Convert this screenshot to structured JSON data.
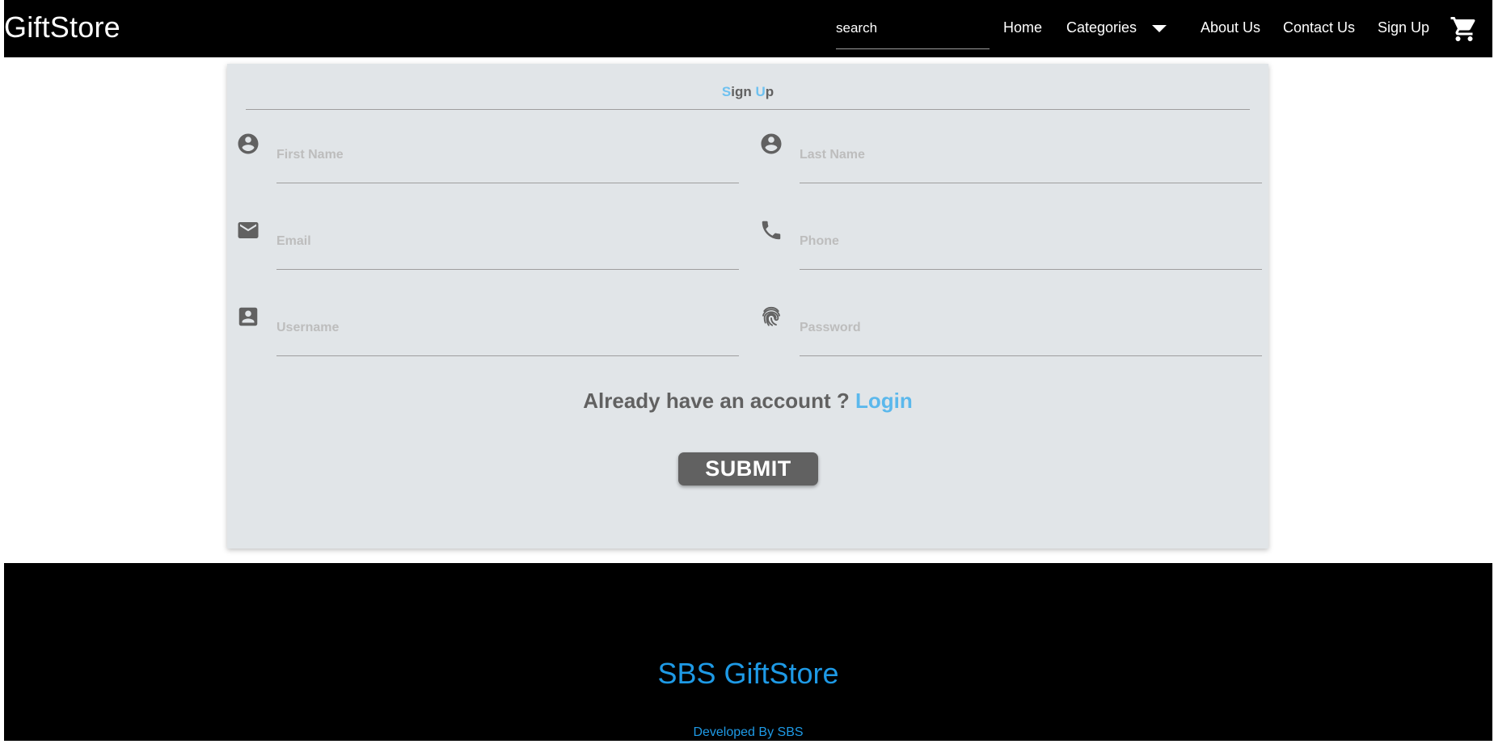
{
  "navbar": {
    "brand": "GiftStore",
    "search_placeholder": "search",
    "links": {
      "home": "Home",
      "categories": "Categories",
      "about": "About Us",
      "contact": "Contact Us",
      "signup": "Sign Up"
    },
    "cart_icon": "shopping-cart-icon",
    "dropdown_icon": "caret-down-icon"
  },
  "form": {
    "title_parts": [
      "S",
      "ign ",
      "U",
      "p"
    ],
    "fields": {
      "first_name": {
        "placeholder": "First Name",
        "value": "",
        "icon": "account-circle-icon"
      },
      "last_name": {
        "placeholder": "Last Name",
        "value": "",
        "icon": "account-circle-icon"
      },
      "email": {
        "placeholder": "Email",
        "value": "",
        "icon": "email-icon"
      },
      "phone": {
        "placeholder": "Phone",
        "value": "",
        "icon": "phone-icon"
      },
      "username": {
        "placeholder": "Username",
        "value": "",
        "icon": "account-box-icon"
      },
      "password": {
        "placeholder": "Password",
        "value": "",
        "icon": "fingerprint-icon"
      }
    },
    "account_prompt": "Already have an account ?",
    "login_link": "Login",
    "submit_label": "SUBMIT"
  },
  "footer": {
    "title": "SBS GiftStore",
    "credit": "Developed By SBS"
  },
  "colors": {
    "navbar_bg": "#000000",
    "card_bg": "#e1e5e8",
    "accent_light_blue": "#5bb8ec",
    "footer_text": "#1e9ae6",
    "icon_gray": "#616161",
    "submit_bg": "#616161"
  }
}
